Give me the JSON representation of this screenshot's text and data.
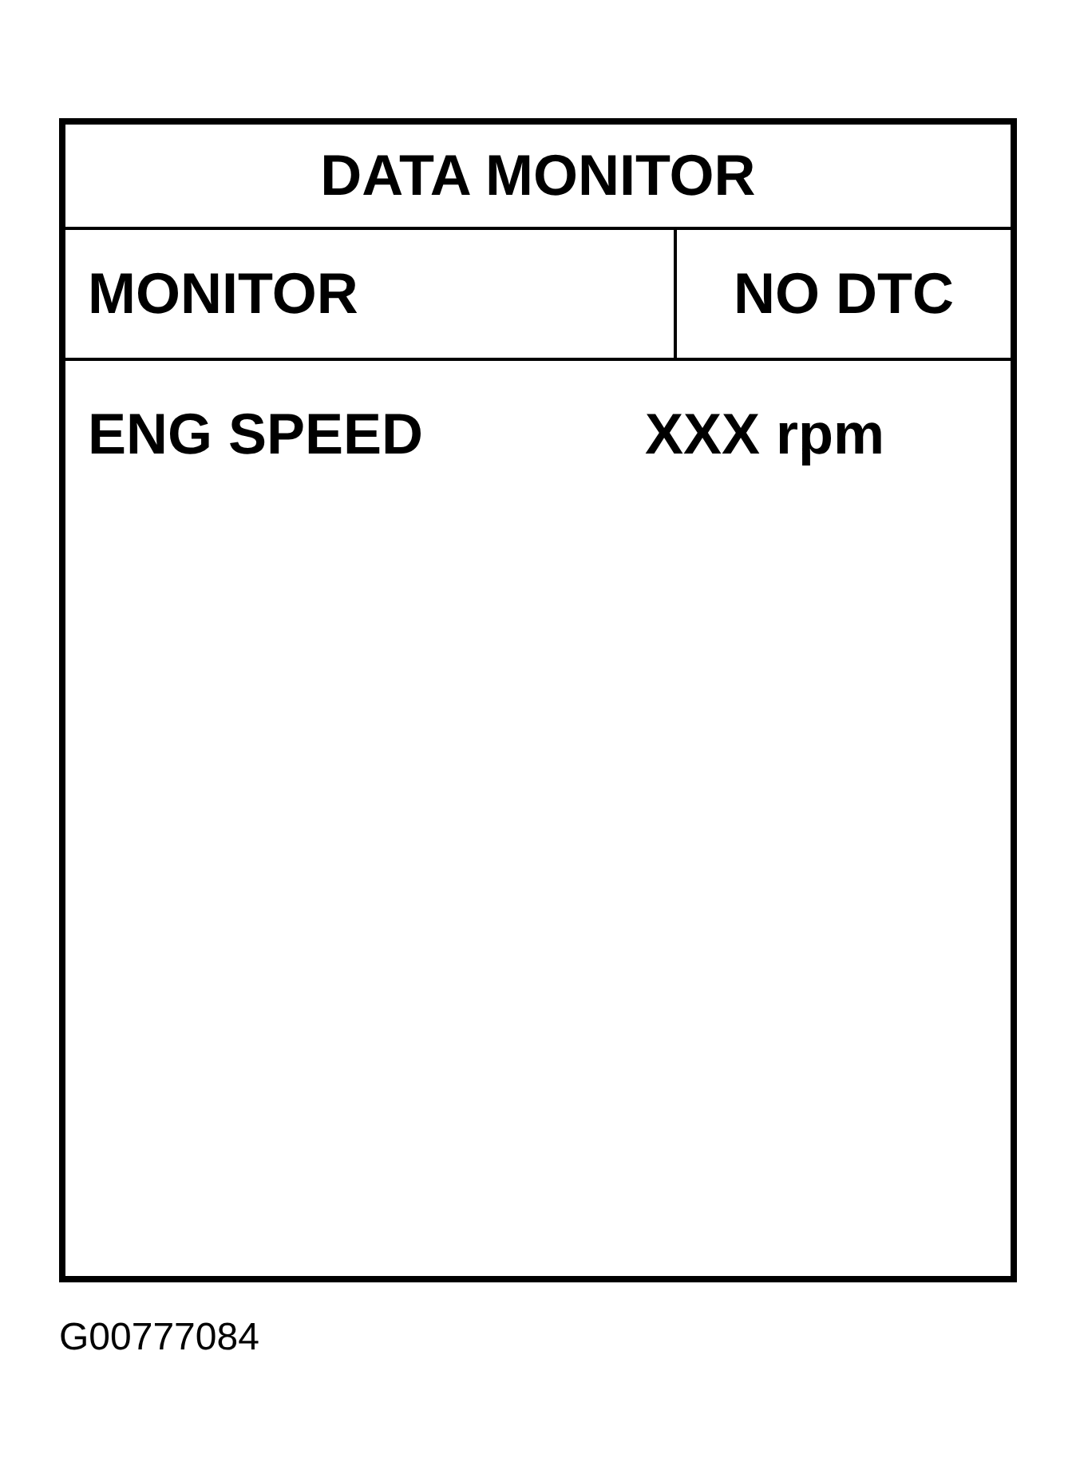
{
  "title": "DATA MONITOR",
  "header": {
    "mode": "MONITOR",
    "status": "NO DTC"
  },
  "rows": [
    {
      "label": "ENG SPEED",
      "value": "XXX rpm"
    }
  ],
  "figure_code": "G00777084"
}
